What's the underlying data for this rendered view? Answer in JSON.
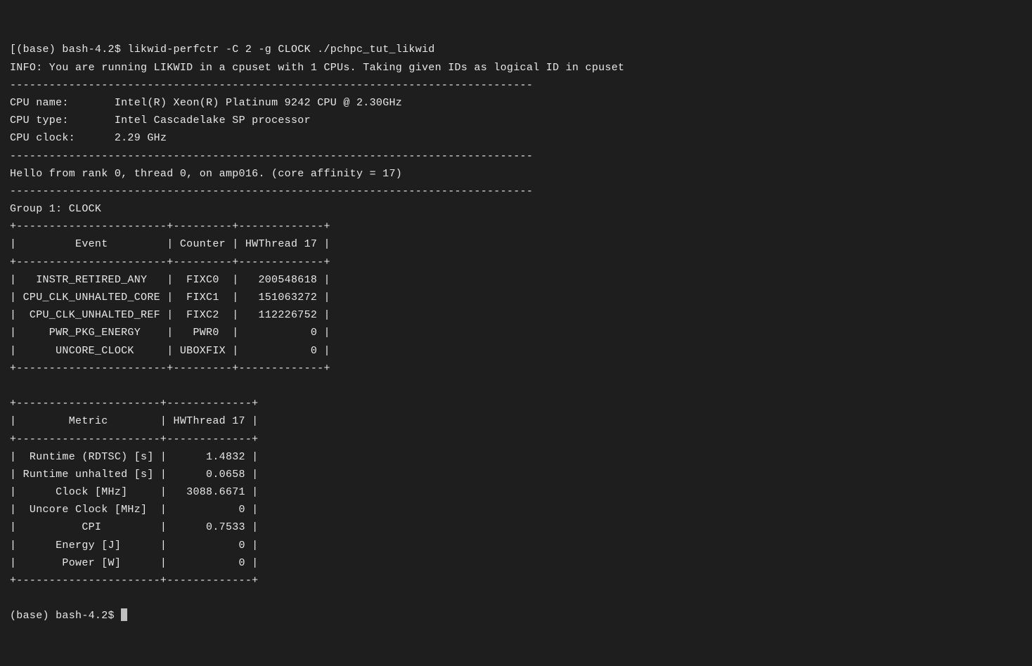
{
  "prompt1": "[(base) bash-4.2$ ",
  "command": "likwid-perfctr -C 2 -g CLOCK ./pchpc_tut_likwid",
  "info_line": "INFO: You are running LIKWID in a cpuset with 1 CPUs. Taking given IDs as logical ID in cpuset",
  "hr": "--------------------------------------------------------------------------------",
  "cpu_name_label": "CPU name:",
  "cpu_name_value": "Intel(R) Xeon(R) Platinum 9242 CPU @ 2.30GHz",
  "cpu_type_label": "CPU type:",
  "cpu_type_value": "Intel Cascadelake SP processor",
  "cpu_clock_label": "CPU clock:",
  "cpu_clock_value": "2.29 GHz",
  "hello_line": "Hello from rank 0, thread 0, on amp016. (core affinity = 17)",
  "group_line": "Group 1: CLOCK",
  "t1_border": "+-----------------------+---------+-------------+",
  "t1_header": "|         Event         | Counter | HWThread 17 |",
  "t1_rows": [
    "|   INSTR_RETIRED_ANY   |  FIXC0  |   200548618 |",
    "| CPU_CLK_UNHALTED_CORE |  FIXC1  |   151063272 |",
    "|  CPU_CLK_UNHALTED_REF |  FIXC2  |   112226752 |",
    "|     PWR_PKG_ENERGY    |   PWR0  |           0 |",
    "|      UNCORE_CLOCK     | UBOXFIX |           0 |"
  ],
  "t2_border": "+----------------------+-------------+",
  "t2_header": "|        Metric        | HWThread 17 |",
  "t2_rows": [
    "|  Runtime (RDTSC) [s] |      1.4832 |",
    "| Runtime unhalted [s] |      0.0658 |",
    "|      Clock [MHz]     |   3088.6671 |",
    "|  Uncore Clock [MHz]  |           0 |",
    "|          CPI         |      0.7533 |",
    "|      Energy [J]      |           0 |",
    "|       Power [W]      |           0 |"
  ],
  "prompt2": "(base) bash-4.2$ "
}
